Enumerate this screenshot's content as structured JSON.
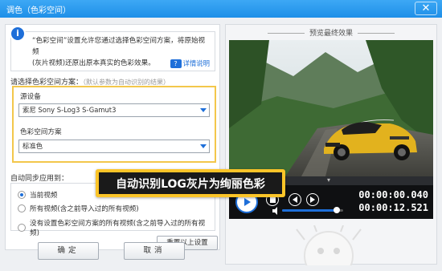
{
  "window": {
    "title": "调色（色彩空间）",
    "close_label": "✕"
  },
  "info": {
    "line1": "“色彩空间”设置允许您通过选择色彩空间方案，将原始视频",
    "line2": "(灰片视频)还原出原本真实的色彩效果。",
    "detail_link": "详情说明",
    "detail_icon_text": "?"
  },
  "scheme": {
    "label": "请选择色彩空间方案：",
    "hint": "（默认参数为自动识别的结果）",
    "device_label": "源设备",
    "device_value": "索尼 Sony S-Log3 S-Gamut3",
    "colorspace_label": "色彩空间方案",
    "colorspace_value": "标准色"
  },
  "sync": {
    "label": "自动同步应用到：",
    "options": [
      {
        "label": "当前视频",
        "selected": true
      },
      {
        "label": "所有视频(含之前导入过的所有视频)",
        "selected": false
      },
      {
        "label": "没有设置色彩空间方案的所有视频(含之前导入过的所有视频)",
        "selected": false
      }
    ]
  },
  "buttons": {
    "reset": "重置以上设置",
    "ok": "确定",
    "cancel": "取消"
  },
  "preview": {
    "title": "预览最终效果",
    "timecode_current": "00:00:00.040",
    "timecode_total": "00:00:12.521",
    "volume_fraction": 0.9
  },
  "callout": {
    "text": "自动识别LOG灰片为绚丽色彩"
  },
  "colors": {
    "accent": "#1e6fd9",
    "highlight": "#f3c74b",
    "callout_bg": "#fbc428",
    "titlebar": "#2a9af0"
  }
}
